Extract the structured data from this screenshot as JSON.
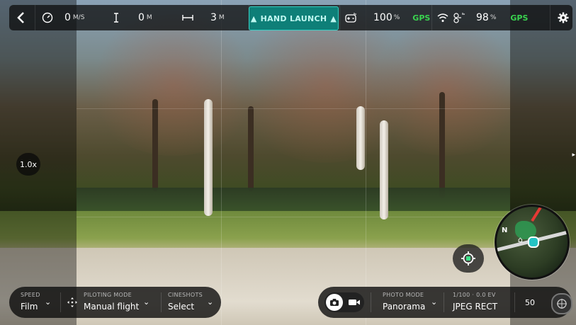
{
  "topbar": {
    "back_icon": "chevron-left-icon",
    "speed": {
      "icon": "speedometer-icon",
      "value": "0",
      "unit": "M/S"
    },
    "altitude": {
      "icon": "altitude-icon",
      "value": "0",
      "unit": "M"
    },
    "distance": {
      "icon": "distance-icon",
      "value": "3",
      "unit": "M"
    },
    "hand_launch": "HAND LAUNCH",
    "controller": {
      "icon": "gamepad-icon",
      "battery": "100",
      "unit": "%",
      "gps": "GPS"
    },
    "drone": {
      "wifi_icon": "wifi-icon",
      "drone_icon": "drone-icon",
      "battery": "98",
      "unit": "%",
      "gps": "GPS"
    },
    "settings_icon": "gear-icon"
  },
  "zoom": "1.0x",
  "left_controls": {
    "speed": {
      "label": "SPEED",
      "value": "Film"
    },
    "piloting": {
      "label": "PILOTING MODE",
      "value": "Manual flight"
    },
    "cineshots": {
      "label": "CINESHOTS",
      "value": "Select"
    }
  },
  "right_controls": {
    "photo_mode": {
      "label": "PHOTO MODE",
      "value": "Panorama"
    },
    "exposure": {
      "label": "1/100 · 0.0 EV",
      "value": "JPEG RECT"
    },
    "iso": "50"
  },
  "minimap": {
    "north_label": "N"
  },
  "colors": {
    "accent": "#39d0c4",
    "gps": "#39d34f",
    "hand_launch_bg": "#0e7f78"
  }
}
